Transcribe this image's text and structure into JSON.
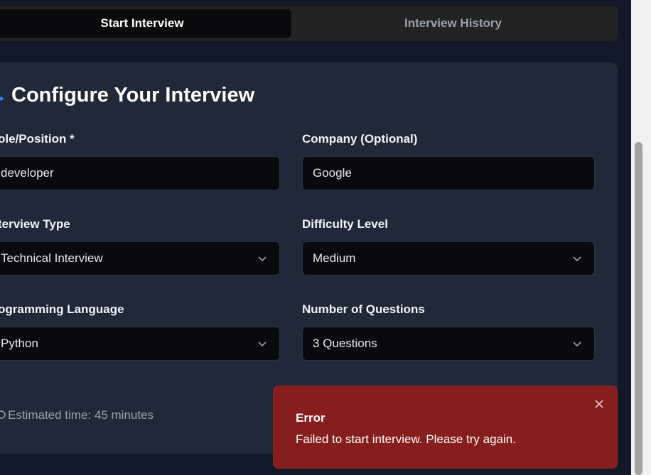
{
  "tabs": {
    "start_label": "Start Interview",
    "history_label": "Interview History"
  },
  "config": {
    "title": "Configure Your Interview",
    "role": {
      "label": "ole/Position *",
      "value": "developer"
    },
    "company": {
      "label": "Company (Optional)",
      "value": "Google"
    },
    "interview_type": {
      "label": "terview Type",
      "value": "Technical Interview"
    },
    "difficulty": {
      "label": "Difficulty Level",
      "value": "Medium"
    },
    "language": {
      "label": "ogramming Language",
      "value": "Python"
    },
    "questions": {
      "label": "Number of Questions",
      "value": "3 Questions"
    },
    "estimate": "Estimated time: 45 minutes"
  },
  "toast": {
    "title": "Error",
    "message": "Failed to start interview. Please try again.",
    "color": "#861e1e"
  },
  "icons": {
    "title_icon": "sparkle-icon",
    "dropdown_icon": "chevron-down-icon",
    "close_icon": "close-icon",
    "estimate_icon": "clock-icon"
  }
}
